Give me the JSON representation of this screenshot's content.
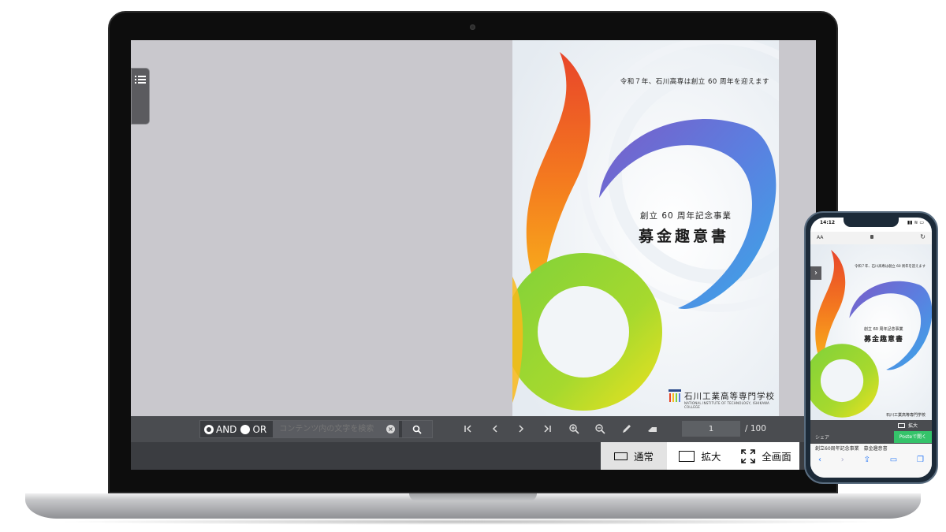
{
  "viewer": {
    "search": {
      "and_label": "AND",
      "or_label": "OR",
      "placeholder": "コンテンツ内の文字を検索"
    },
    "pagination": {
      "current": "1",
      "total": "/ 100"
    },
    "modes": {
      "normal": "通常",
      "zoom": "拡大",
      "full": "全画面"
    }
  },
  "cover": {
    "tagline": "令和７年、石川高専は創立 60 周年を迎えます",
    "subtitle": "創立 60 周年記念事業",
    "title": "募金趣意書",
    "school": "石川工業高等専門学校",
    "school_en": "NATIONAL INSTITUTE OF TECHNOLOGY, ISHIKAWA COLLEGE"
  },
  "phone": {
    "time": "14:12",
    "address_aa": "AA",
    "zoom_label": "拡大",
    "share_label": "シェア",
    "poste_label": "Posteで開く",
    "title_strip": "創立60周年記念事業　募金趣意書"
  },
  "colors": {
    "toolbar": "#4a4c50",
    "viewer_bg": "#c9c8cd",
    "accent_green": "#35c36a",
    "ios_blue": "#2f7cf6"
  }
}
